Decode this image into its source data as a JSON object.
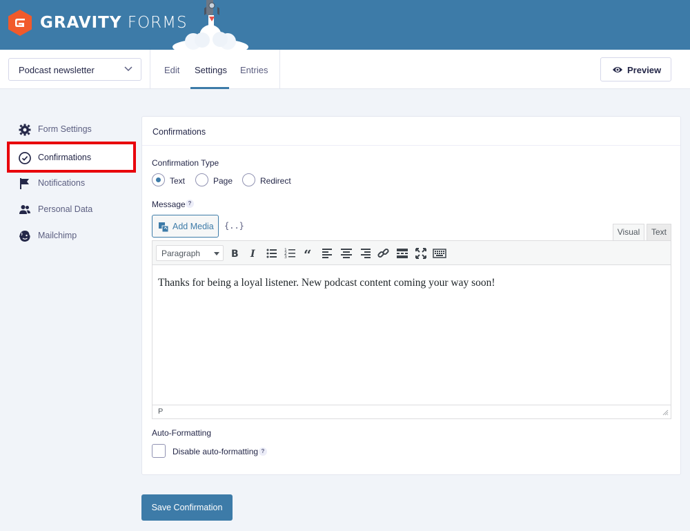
{
  "app": {
    "brand_bold": "GRAVITY",
    "brand_light": "FORMS"
  },
  "toolbar": {
    "form_name": "Podcast newsletter",
    "tabs": [
      {
        "label": "Edit"
      },
      {
        "label": "Settings",
        "active": true
      },
      {
        "label": "Entries"
      }
    ],
    "preview_label": "Preview"
  },
  "sidebar": {
    "items": [
      {
        "label": "Form Settings",
        "icon": "gear-icon"
      },
      {
        "label": "Confirmations",
        "icon": "check-circle-icon",
        "active": true
      },
      {
        "label": "Notifications",
        "icon": "flag-icon"
      },
      {
        "label": "Personal Data",
        "icon": "users-icon"
      },
      {
        "label": "Mailchimp",
        "icon": "mailchimp-icon"
      }
    ]
  },
  "panel": {
    "title": "Confirmations",
    "confirmation_type": {
      "label": "Confirmation Type",
      "options": [
        {
          "label": "Text",
          "checked": true
        },
        {
          "label": "Page",
          "checked": false
        },
        {
          "label": "Redirect",
          "checked": false
        }
      ]
    },
    "message": {
      "label": "Message",
      "help": "?",
      "add_media_label": "Add Media",
      "merge_tags_label": "{..}",
      "mode_tabs": [
        {
          "label": "Visual",
          "active": true
        },
        {
          "label": "Text",
          "active": false
        }
      ],
      "format_select": "Paragraph",
      "content": "Thanks for being a loyal listener. New podcast content coming your way soon!",
      "status_path": "P"
    },
    "auto_formatting": {
      "label": "Auto-Formatting",
      "checkbox_label": "Disable auto-formatting",
      "checked": false,
      "help": "?"
    }
  },
  "save_label": "Save Confirmation",
  "colors": {
    "header_bg": "#3d7ba8",
    "accent": "#3d7ba8",
    "logo_orange": "#f15a2b",
    "highlight_red": "#e8000b",
    "page_bg": "#f1f4f9"
  }
}
